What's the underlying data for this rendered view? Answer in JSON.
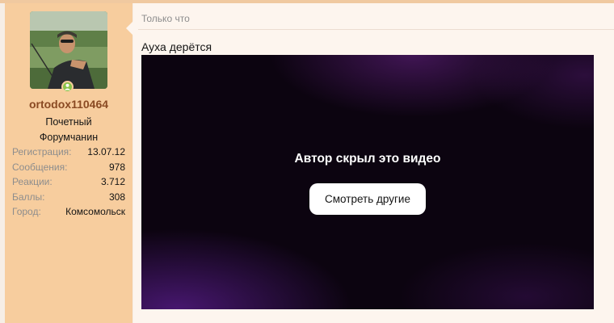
{
  "user": {
    "username": "ortodox110464",
    "title_lines": [
      "Почетный",
      "Форумчанин"
    ],
    "online": true,
    "stats": [
      {
        "label": "Регистрация:",
        "value": "13.07.12"
      },
      {
        "label": "Сообщения:",
        "value": "978"
      },
      {
        "label": "Реакции:",
        "value": "3.712"
      },
      {
        "label": "Баллы:",
        "value": "308"
      },
      {
        "label": "Город:",
        "value": "Комсомольск"
      }
    ]
  },
  "post": {
    "timestamp": "Только что",
    "text": "Ауха дерётся",
    "video": {
      "message": "Автор скрыл это видео",
      "button_label": "Смотреть другие"
    }
  },
  "colors": {
    "sidebar_bg": "#f7cd9e",
    "username": "#8a4a23",
    "online": "#8bc34a",
    "message_bg": "#fdf5ee",
    "video_bg": "#0c0410"
  }
}
